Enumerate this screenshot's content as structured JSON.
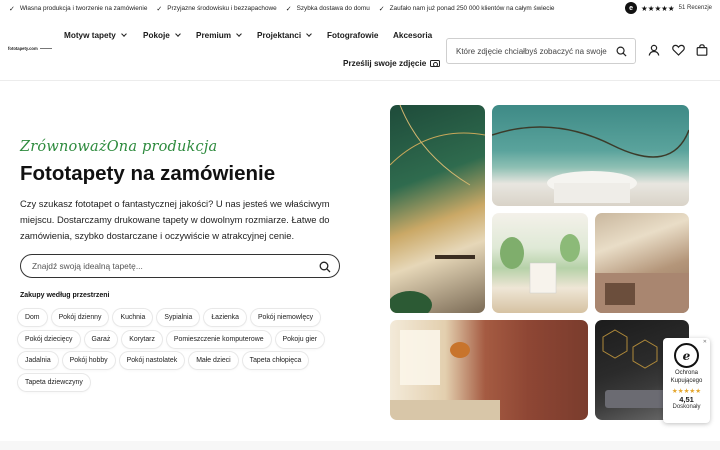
{
  "topbar": {
    "usps": [
      "Własna produkcja i tworzenie na zamówienie",
      "Przyjazne środowisku i bezzapachowe",
      "Szybka dostawa do domu",
      "Zaufało nam już ponad 250 000 klientów na całym świecie"
    ],
    "rating": {
      "badge": "e",
      "stars": "★★★★★",
      "reviews": "51 Recenzje"
    }
  },
  "header": {
    "logo": "fototapety.com",
    "nav": [
      "Motyw tapety",
      "Pokoje",
      "Premium",
      "Projektanci",
      "Fotografowie",
      "Akcesoria"
    ],
    "upload_label": "Prześlij swoje zdjęcie",
    "search_placeholder": "Które zdjęcie chciałbyś zobaczyć na swoje"
  },
  "hero": {
    "tagline": "ZrównoważOna produkcja",
    "title": "Fototapety na zamówienie",
    "description": "Czy szukasz fototapet o fantastycznej jakości? U nas jesteś we właściwym miejscu. Dostarczamy drukowane tapety w dowolnym rozmiarze. Łatwe do zamówienia, szybko dostarczane i oczywiście w atrakcyjnej cenie.",
    "search_placeholder": "Znajdź swoją idealną tapetę...",
    "rooms_title": "Zakupy według przestrzeni",
    "rooms": [
      "Dom",
      "Pokój dzienny",
      "Kuchnia",
      "Sypialnia",
      "Łazienka",
      "Pokój niemowlęcy",
      "Pokój dziecięcy",
      "Garaż",
      "Korytarz",
      "Pomieszczenie komputerowe",
      "Pokoju gier",
      "Jadalnia",
      "Pokój hobby",
      "Pokój nastolatek",
      "Małe dzieci",
      "Tapeta chłopięca",
      "Tapeta dziewczyny"
    ]
  },
  "trusted": {
    "logo": "e",
    "close": "✕",
    "line1": "Ochrona",
    "line2": "Kupującego",
    "stars": "★★★★★",
    "score": "4,51",
    "label": "Doskonały"
  },
  "colors": {
    "accent_green": "#2e8b3e",
    "text": "#111111",
    "star_gold": "#e3a52c"
  }
}
